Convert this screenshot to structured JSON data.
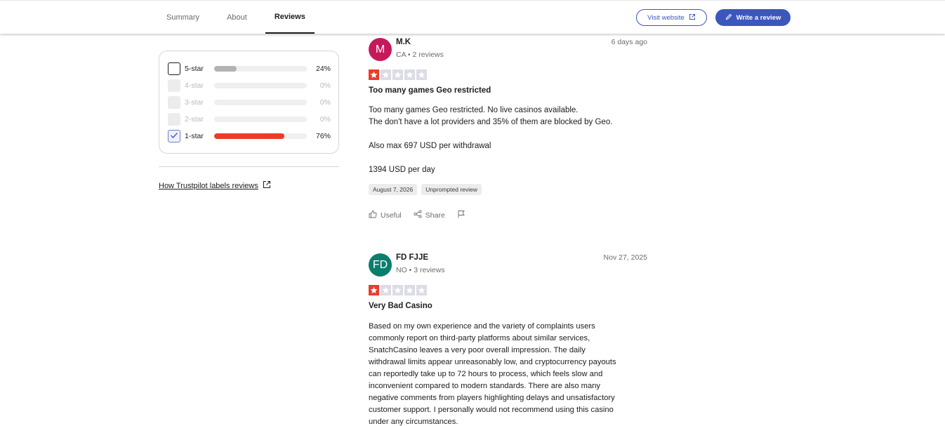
{
  "header": {
    "tabs": [
      {
        "label": "Summary",
        "active": false
      },
      {
        "label": "About",
        "active": false
      },
      {
        "label": "Reviews",
        "active": true
      }
    ],
    "visit_label": "Visit website",
    "write_label": "Write a review",
    "accent_color": "#3c57bc"
  },
  "filters": {
    "rows": [
      {
        "label": "5-star",
        "percent": "24%",
        "fill_fraction": 0.24,
        "checked": false,
        "disabled": false,
        "bar_color": "#b3b3b3"
      },
      {
        "label": "4-star",
        "percent": "0%",
        "fill_fraction": 0,
        "checked": false,
        "disabled": true
      },
      {
        "label": "3-star",
        "percent": "0%",
        "fill_fraction": 0,
        "checked": false,
        "disabled": true
      },
      {
        "label": "2-star",
        "percent": "0%",
        "fill_fraction": 0,
        "checked": false,
        "disabled": true
      },
      {
        "label": "1-star",
        "percent": "76%",
        "fill_fraction": 0.76,
        "checked": true,
        "disabled": false,
        "bar_color": "#ee3b28"
      }
    ],
    "labels_link": "How Trustpilot labels reviews"
  },
  "reviews": [
    {
      "initials": "M",
      "avatar_color": "#c6195b",
      "name": "M.K",
      "meta": "CA • 2 reviews",
      "date": "6 days ago",
      "rating": 1,
      "title": "Too many games Geo restricted",
      "body": [
        "Too many games Geo restricted. No live casinos available.",
        "The don't have a lot providers and 35% of them are blocked by Geo.",
        "",
        "Also max 697 USD per withdrawal",
        "",
        "1394 USD per day"
      ],
      "tags": [
        "August 7, 2026",
        "Unprompted review"
      ],
      "useful": "Useful",
      "share": "Share"
    },
    {
      "initials": "FD",
      "avatar_color": "#0a7e6d",
      "name": "FD FJJE",
      "meta": "NO • 3 reviews",
      "date": "Nov 27, 2025",
      "rating": 1,
      "title": "Very Bad Casino",
      "body": [
        "Based on my own experience and the variety of complaints users",
        "commonly report on third-party platforms about similar services,",
        "SnatchCasino leaves a very poor overall impression. The daily",
        "withdrawal limits appear unreasonably low, and cryptocurrency payouts",
        "can reportedly take up to 72 hours to process, which feels slow and",
        "inconvenient compared to modern standards. There are also many",
        "negative comments from players highlighting delays and unsatisfactory",
        "customer support. I personally would not recommend using this casino",
        "under any circumstances."
      ]
    }
  ]
}
